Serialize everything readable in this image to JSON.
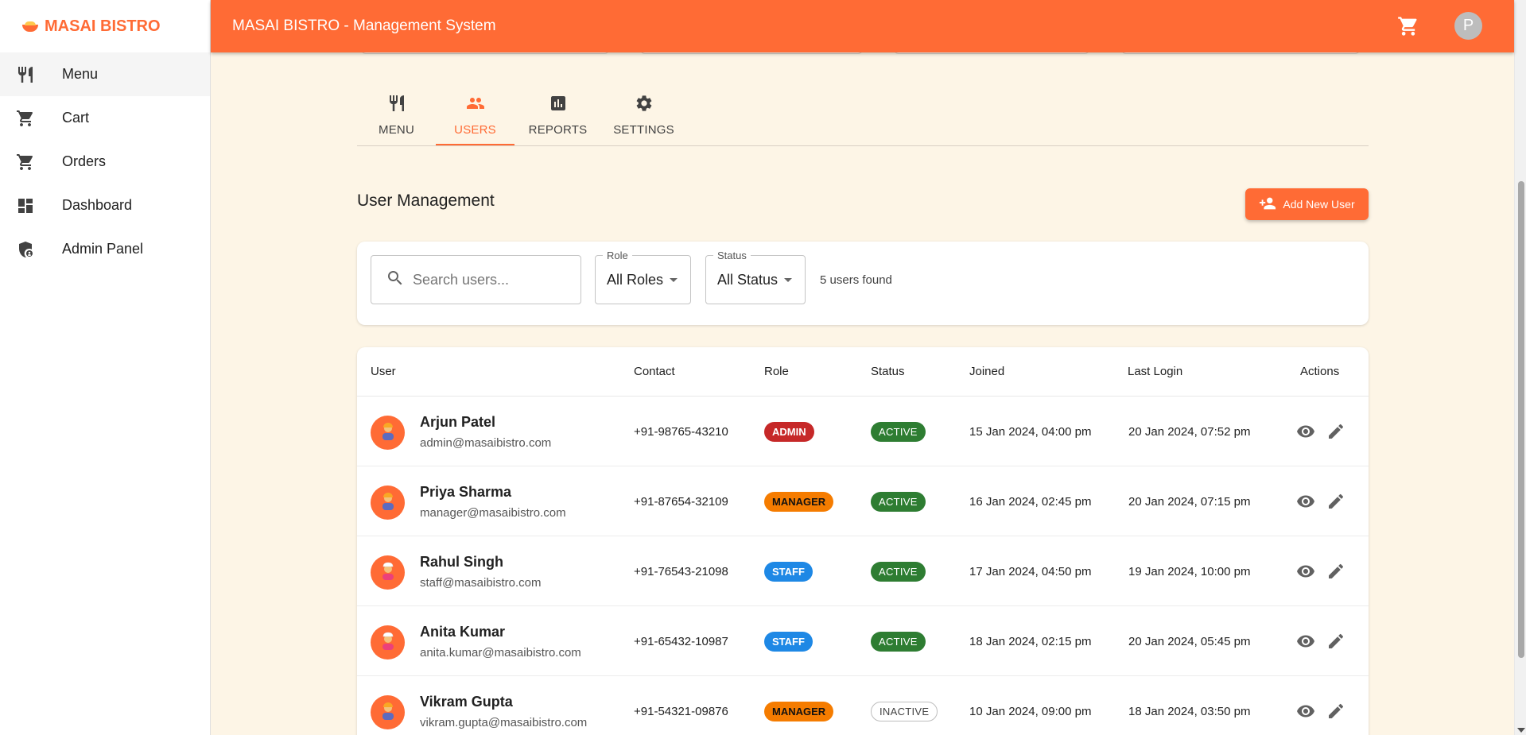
{
  "brand": {
    "name": "MASAI BISTRO"
  },
  "sidebar": {
    "items": [
      {
        "label": "Menu",
        "icon": "restaurant-icon"
      },
      {
        "label": "Cart",
        "icon": "cart-icon"
      },
      {
        "label": "Orders",
        "icon": "cart-icon"
      },
      {
        "label": "Dashboard",
        "icon": "dashboard-icon"
      },
      {
        "label": "Admin Panel",
        "icon": "admin-shield-icon"
      }
    ]
  },
  "topbar": {
    "title": "MASAI BISTRO - Management System",
    "avatar_initial": "P"
  },
  "tabs": [
    {
      "label": "MENU",
      "icon": "restaurant-icon",
      "active": false
    },
    {
      "label": "USERS",
      "icon": "people-icon",
      "active": true
    },
    {
      "label": "REPORTS",
      "icon": "bar-chart-icon",
      "active": false
    },
    {
      "label": "SETTINGS",
      "icon": "gear-icon",
      "active": false
    }
  ],
  "user_management": {
    "title": "User Management",
    "add_button": "Add New User",
    "search_placeholder": "Search users...",
    "role_filter": {
      "label": "Role",
      "value": "All Roles"
    },
    "status_filter": {
      "label": "Status",
      "value": "All Status"
    },
    "count_text": "5 users found"
  },
  "table": {
    "headers": {
      "user": "User",
      "contact": "Contact",
      "role": "Role",
      "status": "Status",
      "joined": "Joined",
      "last_login": "Last Login",
      "actions": "Actions"
    },
    "rows": [
      {
        "name": "Arjun Patel",
        "email": "admin@masaibistro.com",
        "contact": "+91-98765-43210",
        "role": "ADMIN",
        "status": "ACTIVE",
        "joined": "15 Jan 2024, 04:00 pm",
        "last_login": "20 Jan 2024, 07:52 pm"
      },
      {
        "name": "Priya Sharma",
        "email": "manager@masaibistro.com",
        "contact": "+91-87654-32109",
        "role": "MANAGER",
        "status": "ACTIVE",
        "joined": "16 Jan 2024, 02:45 pm",
        "last_login": "20 Jan 2024, 07:15 pm"
      },
      {
        "name": "Rahul Singh",
        "email": "staff@masaibistro.com",
        "contact": "+91-76543-21098",
        "role": "STAFF",
        "status": "ACTIVE",
        "joined": "17 Jan 2024, 04:50 pm",
        "last_login": "19 Jan 2024, 10:00 pm"
      },
      {
        "name": "Anita Kumar",
        "email": "anita.kumar@masaibistro.com",
        "contact": "+91-65432-10987",
        "role": "STAFF",
        "status": "ACTIVE",
        "joined": "18 Jan 2024, 02:15 pm",
        "last_login": "20 Jan 2024, 05:45 pm"
      },
      {
        "name": "Vikram Gupta",
        "email": "vikram.gupta@masaibistro.com",
        "contact": "+91-54321-09876",
        "role": "MANAGER",
        "status": "INACTIVE",
        "joined": "10 Jan 2024, 09:00 pm",
        "last_login": "18 Jan 2024, 03:50 pm"
      }
    ]
  },
  "colors": {
    "accent": "#ff6b35",
    "background": "#fdf5e6",
    "admin": "#c62828",
    "manager": "#f57c00",
    "staff": "#1e88e5",
    "active": "#2e7d32"
  }
}
